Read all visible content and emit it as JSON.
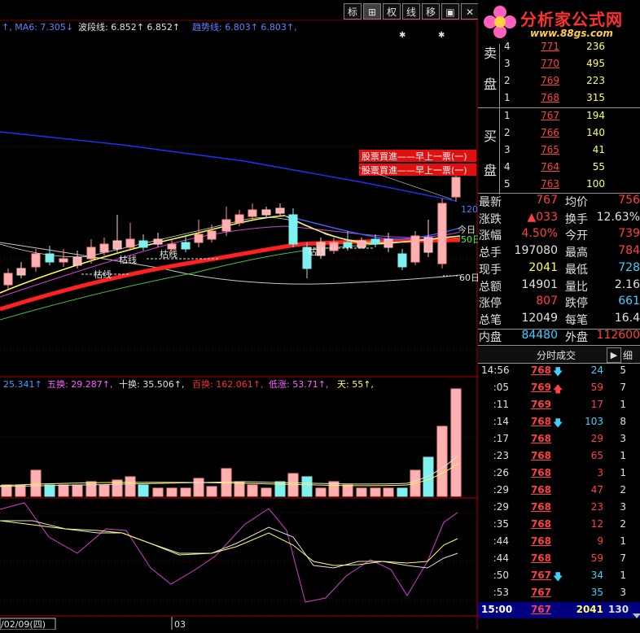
{
  "toolbar": {
    "buttons": [
      {
        "label": "标",
        "active": false
      },
      {
        "label": "⊞",
        "active": true
      },
      {
        "label": "权",
        "active": false
      },
      {
        "label": "线",
        "active": false
      },
      {
        "label": "移",
        "active": false
      },
      {
        "label": "▣",
        "active": false
      },
      {
        "label": "✕",
        "active": false
      }
    ]
  },
  "logo": {
    "title": "分析家公式网",
    "url": "www.88gs.com"
  },
  "main_legend": [
    {
      "text": "↑, MA6: 7.305↓",
      "color": "#6080ff"
    },
    {
      "text": "波段线: 6.852↑ 6.852↑",
      "color": "#e0e0e0"
    },
    {
      "text": "趋势线: 6.803↑ 6.803↑,",
      "color": "#6080ff"
    }
  ],
  "main_annotations": {
    "signal1": "股票買進——早上一票(一)",
    "signal2": "股票買進——早上一票(一)",
    "kulines": [
      "枯线",
      "枯线",
      "枯线",
      "枯线"
    ],
    "right_labels": [
      "120",
      "今日",
      "50日",
      "60日"
    ]
  },
  "vol_legend": [
    {
      "text": "25.341↑",
      "color": "#40a0ff"
    },
    {
      "text": "五换: 29.287↑,",
      "color": "#ff60ff"
    },
    {
      "text": "十换: 35.506↑,",
      "color": "#e0e0e0"
    },
    {
      "text": "百换: 162.061↑,",
      "color": "#ff3030"
    },
    {
      "text": "低涨: 53.71↑,",
      "color": "#ff60ff"
    },
    {
      "text": "天: 55↑,",
      "color": "#ffff60"
    }
  ],
  "date_axis": {
    "date": "/02/09(四)",
    "tick": "03"
  },
  "orderbook": {
    "sell_label": [
      "卖",
      "盘"
    ],
    "buy_label": [
      "买",
      "盘"
    ],
    "sell": [
      {
        "level": "4",
        "price": "771",
        "vol": "236"
      },
      {
        "level": "3",
        "price": "770",
        "vol": "495"
      },
      {
        "level": "2",
        "price": "769",
        "vol": "223"
      },
      {
        "level": "1",
        "price": "768",
        "vol": "315"
      }
    ],
    "buy": [
      {
        "level": "1",
        "price": "767",
        "vol": "194"
      },
      {
        "level": "2",
        "price": "766",
        "vol": "140"
      },
      {
        "level": "3",
        "price": "765",
        "vol": "41"
      },
      {
        "level": "4",
        "price": "764",
        "vol": "55"
      },
      {
        "level": "5",
        "price": "763",
        "vol": "100"
      }
    ]
  },
  "stats": [
    {
      "k1": "最新",
      "v1": "767",
      "c1": "#ff4040",
      "k2": "均价",
      "v2": "756",
      "c2": "#ff4040"
    },
    {
      "k1": "涨跌",
      "v1": "▲033",
      "c1": "#ff4040",
      "k2": "换手",
      "v2": "12.63%",
      "c2": "#e0e0e0"
    },
    {
      "k1": "涨幅",
      "v1": "4.50%",
      "c1": "#ff4040",
      "k2": "今开",
      "v2": "739",
      "c2": "#ff4040"
    },
    {
      "k1": "总手",
      "v1": "197080",
      "c1": "#e0e0e0",
      "k2": "最高",
      "v2": "784",
      "c2": "#ff4040"
    },
    {
      "k1": "现手",
      "v1": "2041",
      "c1": "#ffff60",
      "k2": "最低",
      "v2": "728",
      "c2": "#40d0ff"
    },
    {
      "k1": "总额",
      "v1": "14901",
      "c1": "#e0e0e0",
      "k2": "量比",
      "v2": "2.16",
      "c2": "#e0e0e0"
    },
    {
      "k1": "涨停",
      "v1": "807",
      "c1": "#ff4040",
      "k2": "跌停",
      "v2": "661",
      "c2": "#40d0ff"
    },
    {
      "k1": "总笔",
      "v1": "12049",
      "c1": "#e0e0e0",
      "k2": "每笔",
      "v2": "16.4",
      "c2": "#e0e0e0"
    },
    {
      "k1": "内盘",
      "v1": "84480",
      "c1": "#40d0ff",
      "k2": "外盘",
      "v2": "112600",
      "c2": "#ff4040"
    }
  ],
  "ticks_header": {
    "title": "分时成交",
    "play": "▶",
    "detail": "细"
  },
  "ticks": [
    {
      "time": "14:56",
      "price": "768",
      "arrow": "down",
      "vol": "24",
      "vcolor": "#40d0ff",
      "n": "5"
    },
    {
      "time": ":05",
      "price": "769",
      "arrow": "up",
      "vol": "59",
      "vcolor": "#ff4040",
      "n": "7"
    },
    {
      "time": ":11",
      "price": "769",
      "arrow": "",
      "vol": "17",
      "vcolor": "#ff4040",
      "n": "1"
    },
    {
      "time": ":14",
      "price": "768",
      "arrow": "down",
      "vol": "103",
      "vcolor": "#40d0ff",
      "n": "8"
    },
    {
      "time": ":17",
      "price": "768",
      "arrow": "",
      "vol": "29",
      "vcolor": "#ff4040",
      "n": "3"
    },
    {
      "time": ":23",
      "price": "768",
      "arrow": "",
      "vol": "65",
      "vcolor": "#ff4040",
      "n": "1"
    },
    {
      "time": ":26",
      "price": "768",
      "arrow": "",
      "vol": "3",
      "vcolor": "#ff4040",
      "n": "1"
    },
    {
      "time": ":29",
      "price": "768",
      "arrow": "",
      "vol": "47",
      "vcolor": "#ff4040",
      "n": "2"
    },
    {
      "time": ":29",
      "price": "768",
      "arrow": "",
      "vol": "23",
      "vcolor": "#ff4040",
      "n": "3"
    },
    {
      "time": ":35",
      "price": "768",
      "arrow": "",
      "vol": "12",
      "vcolor": "#ff4040",
      "n": "2"
    },
    {
      "time": ":44",
      "price": "768",
      "arrow": "",
      "vol": "9",
      "vcolor": "#ff4040",
      "n": "1"
    },
    {
      "time": ":44",
      "price": "768",
      "arrow": "",
      "vol": "59",
      "vcolor": "#ff4040",
      "n": "7"
    },
    {
      "time": ":50",
      "price": "767",
      "arrow": "down",
      "vol": "34",
      "vcolor": "#40d0ff",
      "n": "1"
    },
    {
      "time": ":53",
      "price": "767",
      "arrow": "",
      "vol": "35",
      "vcolor": "#40d0ff",
      "n": "3"
    }
  ],
  "ticks_last": {
    "time": "15:00",
    "price": "767",
    "vol": "2041",
    "n": "130"
  }
}
